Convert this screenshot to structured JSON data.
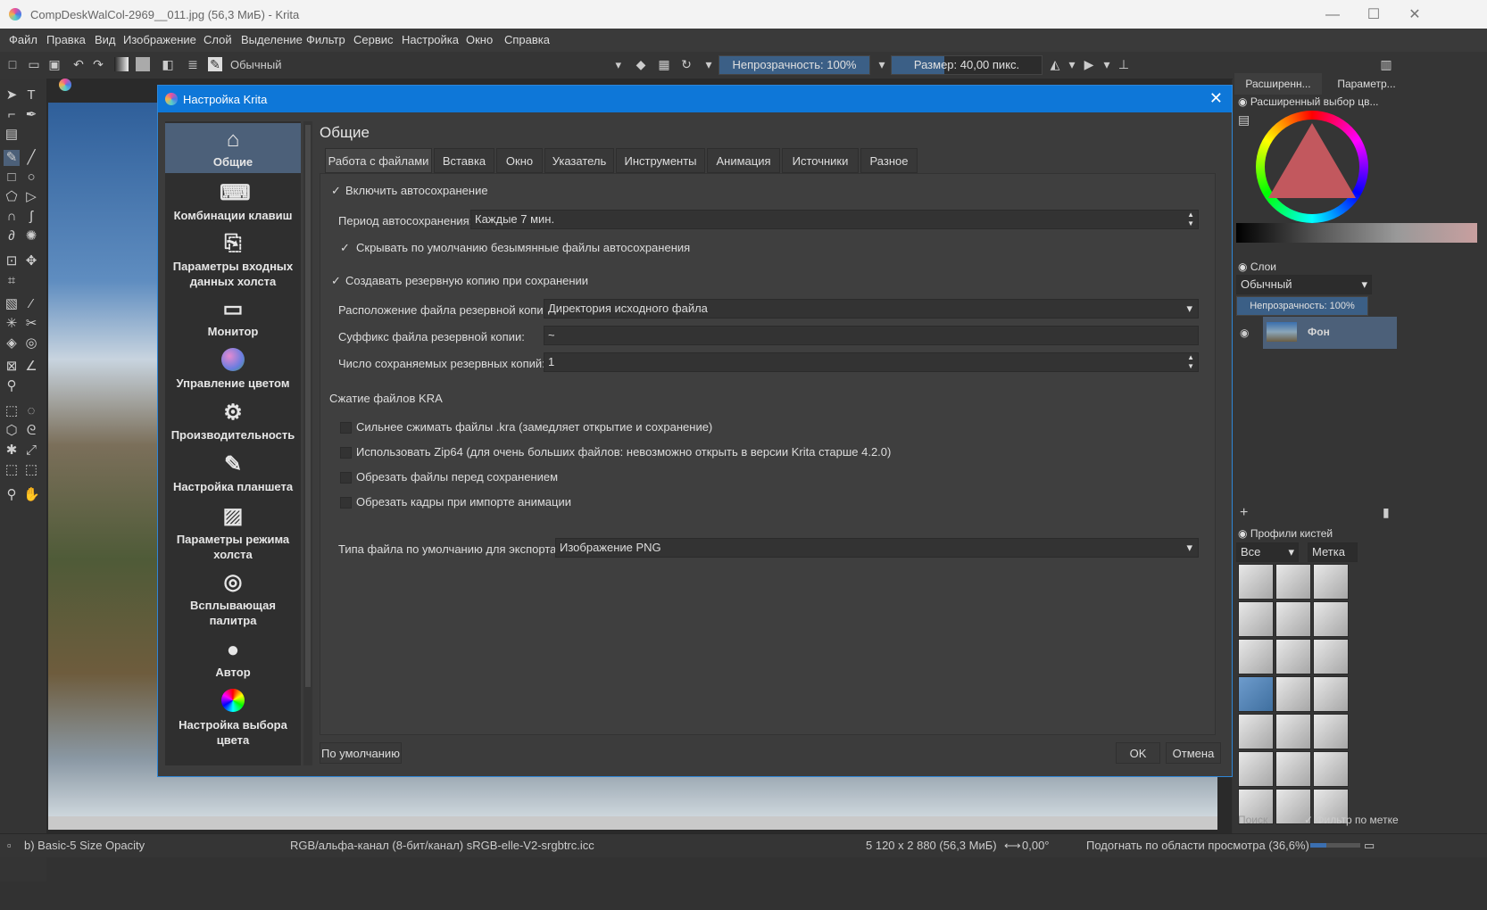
{
  "window": {
    "title": "CompDeskWalCol-2969__011.jpg (56,3 МиБ)  - Krita"
  },
  "menu": [
    "Файл",
    "Правка",
    "Вид",
    "Изображение",
    "Слой",
    "Выделение",
    "Фильтр",
    "Сервис",
    "Настройка",
    "Окно",
    "Справка"
  ],
  "toolbar": {
    "blend_mode": "Обычный",
    "opacity": "Непрозрачность: 100%",
    "opacity_fraction": 1.0,
    "size": "Размер: 40,00 пикс.",
    "size_fraction": 0.35
  },
  "canvas_tab": "CompDeskWalCol-2969__011.jpg (56,3 МиБ)",
  "dialog": {
    "title": "Настройка Krita",
    "section_title": "Общие",
    "sidebar": [
      {
        "label": "Общие",
        "icon": "home-icon"
      },
      {
        "label": "Комбинации клавиш",
        "icon": "keyboard-icon"
      },
      {
        "label": "Параметры входных данных холста",
        "icon": "input-icon"
      },
      {
        "label": "Монитор",
        "icon": "monitor-icon"
      },
      {
        "label": "Управление цветом",
        "icon": "color-management-icon"
      },
      {
        "label": "Производительность",
        "icon": "gears-icon"
      },
      {
        "label": "Настройка планшета",
        "icon": "tablet-icon"
      },
      {
        "label": "Параметры режима холста",
        "icon": "canvas-mode-icon"
      },
      {
        "label": "Всплывающая палитра",
        "icon": "popup-palette-icon"
      },
      {
        "label": "Автор",
        "icon": "author-icon"
      },
      {
        "label": "Настройка выбора цвета",
        "icon": "color-selector-icon"
      }
    ],
    "tabs": [
      "Работа с файлами",
      "Вставка",
      "Окно",
      "Указатель",
      "Инструменты",
      "Анимация",
      "Источники",
      "Разное"
    ],
    "autosave_enable": "Включить автосохранение",
    "autosave_period_label": "Период автосохранения:",
    "autosave_period_value": "Каждые 7 мин.",
    "hide_unnamed_autosave": "Скрывать по умолчанию безымянные файлы автосохранения",
    "create_backup": "Создавать резервную копию при сохранении",
    "backup_location_label": "Расположение файла резервной копии",
    "backup_location_value": "Директория исходного файла",
    "backup_suffix_label": "Суффикс файла резервной копии:",
    "backup_suffix_value": "~",
    "backup_count_label": "Число сохраняемых резервных копий:",
    "backup_count_value": "1",
    "kra_compression_title": "Сжатие файлов KRA",
    "kra_options": [
      "Сильнее сжимать файлы .kra (замедляет открытие и сохранение)",
      "Использовать Zip64 (для очень больших файлов: невозможно открыть в версии Krita старше 4.2.0)",
      "Обрезать файлы перед сохранением",
      "Обрезать кадры при импорте анимации"
    ],
    "export_type_label": "Типа файла по умолчанию для экспорта:",
    "export_type_value": "Изображение PNG",
    "defaults_button": "По умолчанию",
    "ok_button": "OK",
    "cancel_button": "Отмена"
  },
  "docker": {
    "tabs": [
      "Расширенн...",
      "Параметр..."
    ],
    "color_selector_title": "Расширенный выбор цв...",
    "layers_title": "Слои",
    "layers_blend": "Обычный",
    "layers_opacity": "Непрозрачность: 100%",
    "layer_name": "Фон",
    "brush_title": "Профили кистей",
    "brush_filter": "Все",
    "brush_tag": "Метка",
    "brush_search": "Поиск",
    "brush_filter_by_tag": "Фильтр по метке"
  },
  "statusbar": {
    "brush": "b) Basic-5 Size Opacity",
    "color_model": "RGB/альфа-канал (8-бит/канал)  sRGB-elle-V2-srgbtrc.icc",
    "dimensions": "5 120 x 2 880 (56,3 МиБ)",
    "rotation": "0,00°",
    "zoom": "Подогнать по области просмотра (36,6%)"
  },
  "colors": {
    "accent": "#0e77d8",
    "selection": "#4c6079",
    "slider": "#3b5f86"
  }
}
